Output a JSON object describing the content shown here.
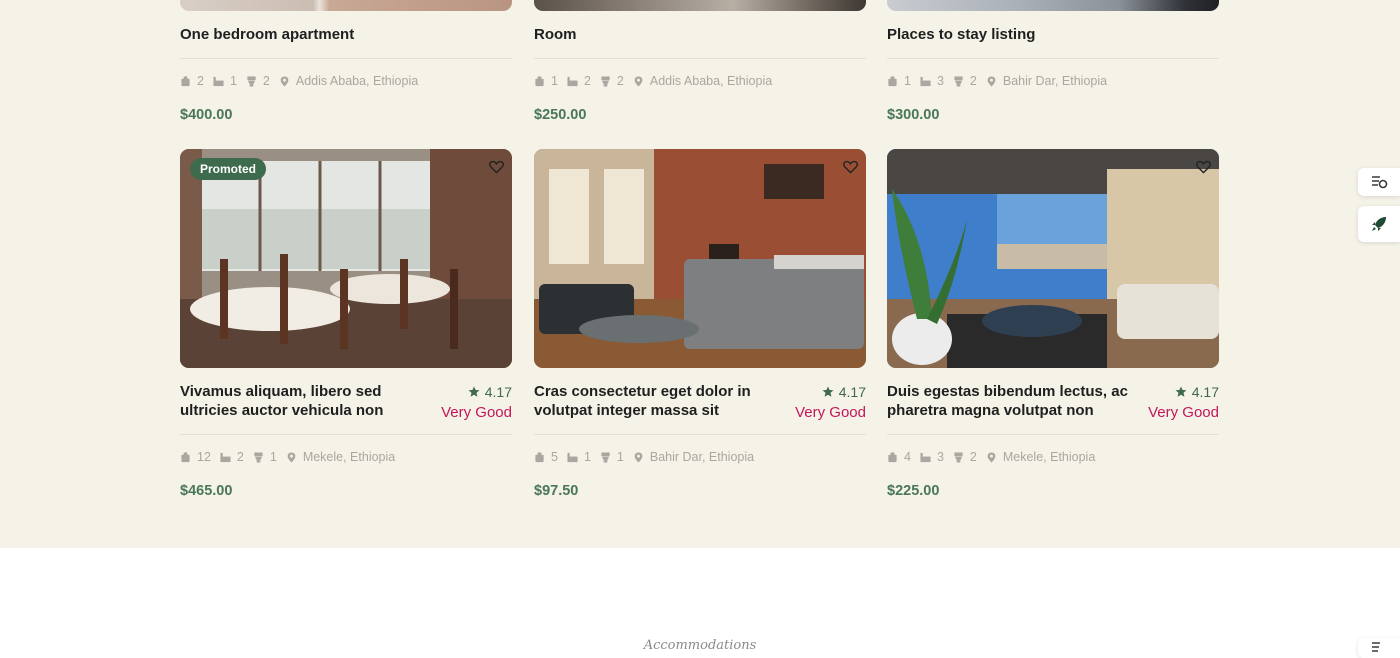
{
  "top_listings": [
    {
      "title": "One bedroom apartment",
      "beds": "2",
      "baths": "1",
      "toilets": "2",
      "location": "Addis Ababa, Ethiopia",
      "price": "$400.00"
    },
    {
      "title": "Room",
      "beds": "1",
      "baths": "2",
      "toilets": "2",
      "location": "Addis Ababa, Ethiopia",
      "price": "$250.00"
    },
    {
      "title": "Places to stay listing",
      "beds": "1",
      "baths": "3",
      "toilets": "2",
      "location": "Bahir Dar, Ethiopia",
      "price": "$300.00"
    }
  ],
  "listings": [
    {
      "title": "Vivamus aliquam, libero sed ultricies auctor vehicula non",
      "rating": "4.17",
      "rating_word": "Very Good",
      "beds": "12",
      "baths": "2",
      "toilets": "1",
      "location": "Mekele, Ethiopia",
      "price": "$465.00",
      "badge": "Promoted"
    },
    {
      "title": "Cras consectetur eget dolor in volutpat integer massa sit",
      "rating": "4.17",
      "rating_word": "Very Good",
      "beds": "5",
      "baths": "1",
      "toilets": "1",
      "location": "Bahir Dar, Ethiopia",
      "price": "$97.50"
    },
    {
      "title": "Duis egestas bibendum lectus, ac pharetra magna volutpat non",
      "rating": "4.17",
      "rating_word": "Very Good",
      "beds": "4",
      "baths": "3",
      "toilets": "2",
      "location": "Mekele, Ethiopia",
      "price": "$225.00"
    }
  ],
  "section": {
    "label": "Accommodations"
  },
  "icons": {
    "bed": "bed-icon",
    "bath": "bath-icon",
    "toilet": "toilet-icon",
    "location": "location-pin-icon",
    "heart": "heart-icon",
    "star": "star-icon",
    "compare": "compare-icon",
    "rocket": "rocket-icon"
  },
  "colors": {
    "accent": "#4a7857",
    "rating_word": "#c2185b",
    "badge": "#3e6a4d",
    "background": "#f5f2e8"
  }
}
